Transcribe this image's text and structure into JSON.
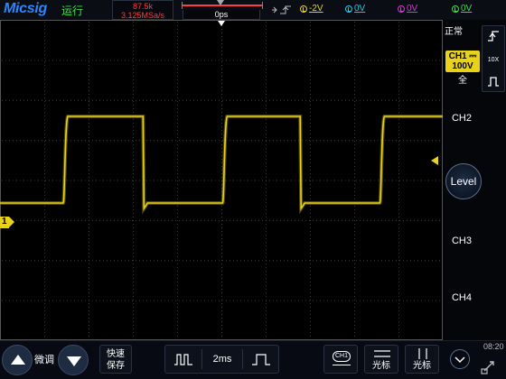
{
  "header": {
    "brand": "Micsig",
    "run_status": "运行",
    "sample_count": "87.5k",
    "sample_rate": "3.125MSa/s",
    "horizontal_position": "0ps",
    "trigger_level_1": "-2V",
    "trigger_level_2": "0V",
    "trigger_level_3": "0V",
    "trigger_level_4": "0V"
  },
  "right_panel": {
    "trigger_mode": "正常",
    "probe_ratio": "10X",
    "ch1_label": "CH1",
    "ch1_coupling": "⎓",
    "ch1_scale": "100V",
    "ch1_bandwidth": "全",
    "ch2_label": "CH2",
    "level_label": "Level",
    "ch3_label": "CH3",
    "ch4_label": "CH4"
  },
  "channel_marker": "1",
  "bottom": {
    "fine_adjust": "微调",
    "quick_save_line1": "快速",
    "quick_save_line2": "保存",
    "timebase": "2ms",
    "ch1_button": "CH1",
    "cursor1_label": "光标",
    "cursor2_label": "光标",
    "clock": "08:20"
  },
  "colors": {
    "ch1": "#e8d21a",
    "ch2": "#19c9e6",
    "ch3": "#d637d6",
    "ch4": "#3ce04a",
    "accent": "#2a86ff",
    "alert": "#ff3d3d"
  },
  "waveform": {
    "type": "square",
    "channel": "CH1",
    "low_to_high": [
      [
        0,
        "low"
      ],
      [
        14.5,
        "high"
      ],
      [
        32.5,
        "low"
      ],
      [
        50.5,
        "high"
      ],
      [
        68.0,
        "low"
      ],
      [
        86.0,
        "high"
      ]
    ]
  }
}
